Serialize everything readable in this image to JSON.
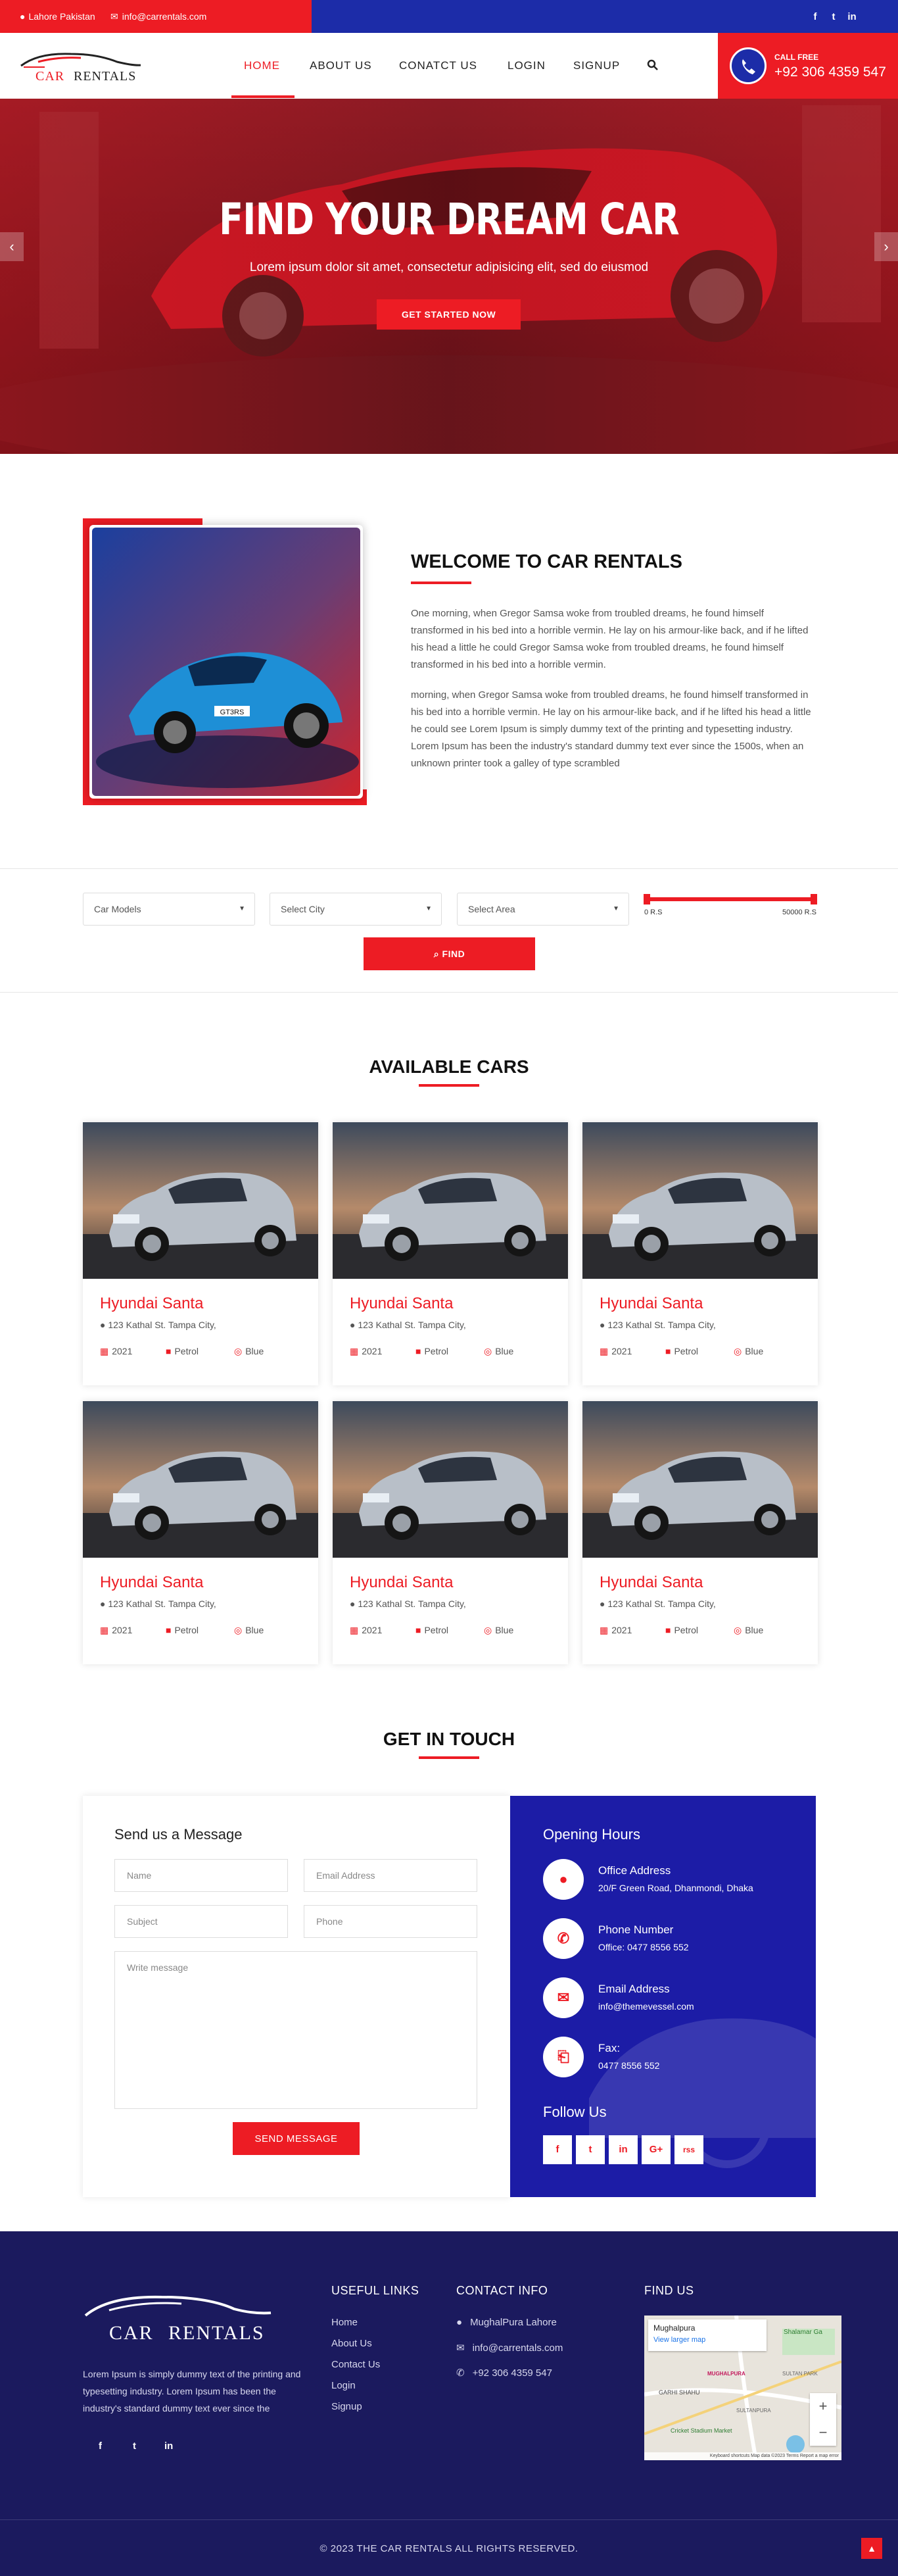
{
  "topbar": {
    "location": "Lahore Pakistan",
    "email": "info@carrentals.com",
    "social": [
      "f",
      "t",
      "in"
    ]
  },
  "brand": {
    "name_left": "CAR",
    "name_right": "RENTALS"
  },
  "nav": {
    "items": [
      "HOME",
      "ABOUT US",
      "CONATCT US",
      "LOGIN",
      "SIGNUP"
    ],
    "active": "HOME"
  },
  "callbox": {
    "label": "CALL FREE",
    "phone": "+92 306 4359 547"
  },
  "hero": {
    "title": "FIND YOUR DREAM CAR",
    "subtitle": "Lorem ipsum dolor sit amet, consectetur adipisicing elit, sed do eiusmod",
    "button": "GET STARTED NOW"
  },
  "welcome": {
    "heading": "WELCOME TO CAR RENTALS",
    "para1": "One morning, when Gregor Samsa woke from troubled dreams, he found himself transformed in his bed into a horrible vermin. He lay on his armour-like back, and if he lifted his head a little he could Gregor Samsa woke from troubled dreams, he found himself transformed in his bed into a horrible vermin.",
    "para2": "morning, when Gregor Samsa woke from troubled dreams, he found himself transformed in his bed into a horrible vermin. He lay on his armour-like back, and if he lifted his head a little he could see Lorem Ipsum is simply dummy text of the printing and typesetting industry. Lorem Ipsum has been the industry's standard dummy text ever since the 1500s, when an unknown printer took a galley of type scrambled",
    "plate": "GT3RS"
  },
  "filter": {
    "models": "Car Models",
    "city": "Select City",
    "area": "Select Area",
    "price_min": "0 R.S",
    "price_max": "50000 R.S",
    "price_range_fraction": [
      0.0,
      1.0
    ],
    "find": "FIND"
  },
  "cars": {
    "heading": "AVAILABLE CARS",
    "items": [
      {
        "name": "Hyundai Santa",
        "address": "123 Kathal St. Tampa City,",
        "year": "2021",
        "fuel": "Petrol",
        "color": "Blue"
      },
      {
        "name": "Hyundai Santa",
        "address": "123 Kathal St. Tampa City,",
        "year": "2021",
        "fuel": "Petrol",
        "color": "Blue"
      },
      {
        "name": "Hyundai Santa",
        "address": "123 Kathal St. Tampa City,",
        "year": "2021",
        "fuel": "Petrol",
        "color": "Blue"
      },
      {
        "name": "Hyundai Santa",
        "address": "123 Kathal St. Tampa City,",
        "year": "2021",
        "fuel": "Petrol",
        "color": "Blue"
      },
      {
        "name": "Hyundai Santa",
        "address": "123 Kathal St. Tampa City,",
        "year": "2021",
        "fuel": "Petrol",
        "color": "Blue"
      },
      {
        "name": "Hyundai Santa",
        "address": "123 Kathal St. Tampa City,",
        "year": "2021",
        "fuel": "Petrol",
        "color": "Blue"
      }
    ]
  },
  "contact": {
    "heading": "GET IN TOUCH",
    "form_title": "Send us a Message",
    "name_ph": "Name",
    "email_ph": "Email Address",
    "subject_ph": "Subject",
    "phone_ph": "Phone",
    "message_ph": "Write message",
    "send": "SEND MESSAGE",
    "hours_title": "Opening Hours",
    "address_h": "Office Address",
    "address_v": "20/F Green Road, Dhanmondi, Dhaka",
    "phone_h": "Phone Number",
    "phone_v": "Office: 0477 8556 552",
    "email_h": "Email Address",
    "email_v": "info@themevessel.com",
    "fax_h": "Fax:",
    "fax_v": "0477 8556 552",
    "follow": "Follow Us",
    "social": [
      "f",
      "t",
      "in",
      "G+",
      "rss"
    ]
  },
  "footer": {
    "about": "Lorem Ipsum is simply dummy text of the printing and typesetting industry. Lorem Ipsum has been the industry's standard dummy text ever since the",
    "links_h": "USEFUL LINKS",
    "links": [
      "Home",
      "About Us",
      "Contact Us",
      "Login",
      "Signup"
    ],
    "contact_h": "CONTACT INFO",
    "addr": "MughalPura Lahore",
    "email": "info@carrentals.com",
    "phone": "+92 306 4359 547",
    "find_h": "FIND US",
    "map_title": "Mughalpura",
    "map_link": "View larger map",
    "map_places": [
      "Shalamar Ga",
      "MUGHALPURA",
      "SULTAN PARK",
      "GARHI SHAHU",
      "SULTANPURA",
      "Cricket Stadium Market"
    ],
    "map_footer": "Keyboard shortcuts  Map data ©2023  Terms  Report a map error",
    "copyright": "© 2023 THE CAR RENTALS ALL RIGHTS RESERVED."
  },
  "colors": {
    "accent": "#ed1c24",
    "navy": "#1c2ca8",
    "footer": "#1b1a5e"
  }
}
